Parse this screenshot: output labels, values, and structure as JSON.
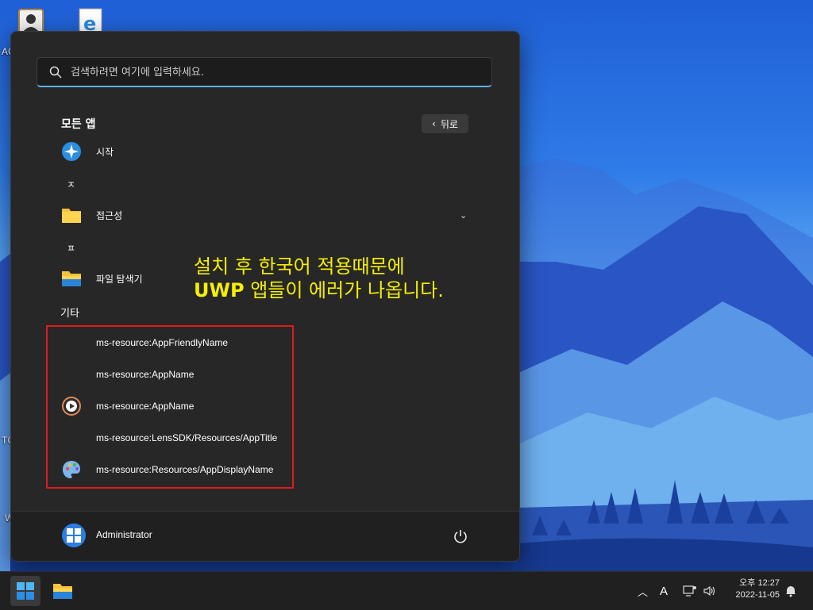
{
  "desktop": {
    "labels": [
      "AC",
      "TC",
      "W"
    ]
  },
  "start_menu": {
    "search": {
      "placeholder": "검색하려면 여기에 입력하세요."
    },
    "section_title": "모든 앱",
    "back_button": "뒤로",
    "apps": [
      {
        "label": "시작",
        "icon": "tips-star-icon"
      },
      {
        "letter": "ㅈ"
      },
      {
        "label": "접근성",
        "icon": "folder-icon",
        "expandable": true
      },
      {
        "letter": "ㅍ"
      },
      {
        "label": "파일 탐색기",
        "icon": "file-explorer-icon"
      }
    ],
    "group_title": "기타",
    "other_apps": [
      {
        "label": "ms-resource:AppFriendlyName",
        "icon": ""
      },
      {
        "label": "ms-resource:AppName",
        "icon": ""
      },
      {
        "label": "ms-resource:AppName",
        "icon": "media-player-icon"
      },
      {
        "label": "ms-resource:LensSDK/Resources/AppTitle",
        "icon": ""
      },
      {
        "label": "ms-resource:Resources/AppDisplayName",
        "icon": "paint-palette-icon"
      }
    ],
    "annotation": {
      "line1": "설치 후 한국어 적용때문에",
      "line2_bold": "UWP",
      "line2_rest": " 앱들이 에러가 나옵니다."
    },
    "user": {
      "name": "Administrator"
    }
  },
  "taskbar": {
    "ime": "A",
    "clock": {
      "time": "오후 12:27",
      "date": "2022-11-05"
    }
  },
  "colors": {
    "accent": "#5fb2f2",
    "highlight_border": "#e0191e",
    "annotation_text": "#f5ef00"
  }
}
